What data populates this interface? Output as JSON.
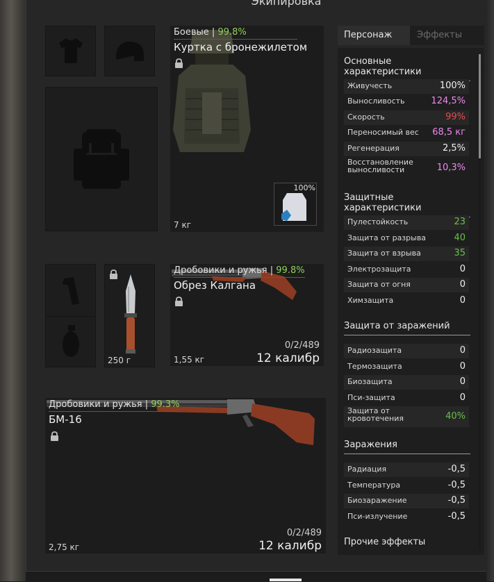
{
  "window": {
    "title": "Экипировка"
  },
  "armor": {
    "category": "Боевые",
    "durability": "99.8%",
    "name": "Куртка с бронежилетом",
    "weight": "7 кг",
    "container_fill": "100%"
  },
  "gear": {
    "knife_weight": "250 г"
  },
  "weapon1": {
    "category": "Дробовики и ружья",
    "durability": "99.8%",
    "name": "Обрез Калгана",
    "weight": "1,55 кг",
    "ammo": "0/2/489",
    "caliber": "12 калибр"
  },
  "weapon2": {
    "category": "Дробовики и ружья",
    "durability": "99.3%",
    "name": "БМ-16",
    "weight": "2,75 кг",
    "ammo": "0/2/489",
    "caliber": "12 калибр"
  },
  "tabs": {
    "character": "Персонаж",
    "effects": "Эффекты"
  },
  "sections": {
    "main": {
      "title": "Основные характеристики",
      "rows": [
        {
          "label": "Живучесть",
          "value": "100%"
        },
        {
          "label": "Выносливость",
          "value": "124,5%"
        },
        {
          "label": "Скорость",
          "value": "99%"
        },
        {
          "label": "Переносимый вес",
          "value": "68,5 кг"
        },
        {
          "label": "Регенерация",
          "value": "2,5%"
        },
        {
          "label": "Восстановление выносливости",
          "value": "10,3%"
        }
      ]
    },
    "protection": {
      "title": "Защитные характеристики",
      "rows": [
        {
          "label": "Пулестойкость",
          "value": "23"
        },
        {
          "label": "Защита от разрыва",
          "value": "40"
        },
        {
          "label": "Защита от взрыва",
          "value": "35"
        },
        {
          "label": "Электрозащита",
          "value": "0"
        },
        {
          "label": "Защита от огня",
          "value": "0"
        },
        {
          "label": "Химзащита",
          "value": "0"
        }
      ]
    },
    "contamination": {
      "title": "Защита от заражений",
      "rows": [
        {
          "label": "Радиозащита",
          "value": "0"
        },
        {
          "label": "Термозащита",
          "value": "0"
        },
        {
          "label": "Биозащита",
          "value": "0"
        },
        {
          "label": "Пси-защита",
          "value": "0"
        },
        {
          "label": "Защита от кровотечения",
          "value": "40%"
        }
      ]
    },
    "infections": {
      "title": "Заражения",
      "rows": [
        {
          "label": "Радиация",
          "value": "-0,5"
        },
        {
          "label": "Температура",
          "value": "-0,5"
        },
        {
          "label": "Биозаражение",
          "value": "-0,5"
        },
        {
          "label": "Пси-излучение",
          "value": "-0,5"
        }
      ]
    },
    "other": {
      "title": "Прочие эффекты"
    }
  },
  "colors": {
    "durability_green": "#8fd15b",
    "stat_pink": "#ee88ee",
    "stat_red": "#e84c4c",
    "stat_green": "#67c04a"
  },
  "icons": [
    "shirt-icon",
    "helmet-icon",
    "backpack-icon",
    "lock-icon",
    "flashlight-icon",
    "grenade-icon",
    "knife-icon",
    "armor-vest-image",
    "container-image",
    "sawed-off-shotgun-image",
    "shotgun-image"
  ]
}
